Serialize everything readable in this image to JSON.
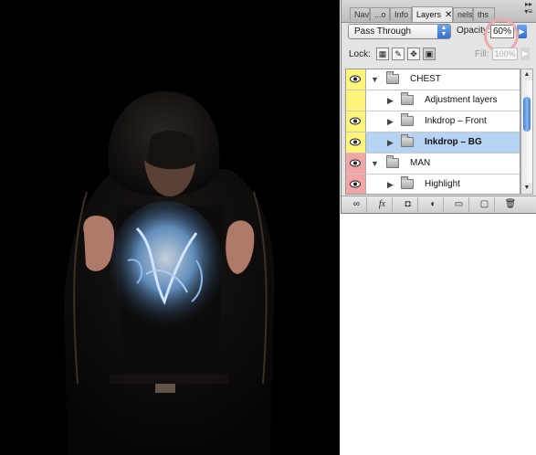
{
  "canvas": {
    "background": "#000000",
    "subject": "hooded-man-with-inkdrop-chest"
  },
  "layers_panel": {
    "tabs": [
      {
        "label": "Nav",
        "active": false
      },
      {
        "label": "...o",
        "active": false
      },
      {
        "label": "Info",
        "active": false
      },
      {
        "label": "Layers",
        "active": true,
        "close": "✕"
      },
      {
        "label": "nels",
        "active": false
      },
      {
        "label": "ths",
        "active": false
      }
    ],
    "panel_menu_icon": "panel-menu-icon",
    "blend_mode": "Pass Through",
    "opacity_label": "Opacity:",
    "opacity_value": "60%",
    "lock_label": "Lock:",
    "fill_label": "Fill:",
    "fill_value": "100%",
    "layers": [
      {
        "name": "CHEST",
        "type": "group",
        "expanded": true,
        "indent": 0,
        "visible": true,
        "color": "#fff57a",
        "selected": false
      },
      {
        "name": "Adjustment layers",
        "type": "group",
        "expanded": false,
        "indent": 1,
        "visible": false,
        "color": "#fff57a",
        "selected": false
      },
      {
        "name": "Inkdrop – Front",
        "type": "group",
        "expanded": false,
        "indent": 1,
        "visible": true,
        "color": "#fff57a",
        "selected": false
      },
      {
        "name": "Inkdrop – BG",
        "type": "group",
        "expanded": false,
        "indent": 1,
        "visible": true,
        "color": "#fff57a",
        "selected": true
      },
      {
        "name": "MAN",
        "type": "group",
        "expanded": true,
        "indent": 0,
        "visible": true,
        "color": "#f3a6a6",
        "selected": false
      },
      {
        "name": "Highlight",
        "type": "group",
        "expanded": false,
        "indent": 1,
        "visible": true,
        "color": "#f3a6a6",
        "selected": false
      }
    ],
    "bottom_tools": [
      "link-icon",
      "fx-icon",
      "mask-icon",
      "adjustment-icon",
      "new-group-icon",
      "new-layer-icon",
      "trash-icon"
    ],
    "bottom_tool_labels": [
      "∞",
      "fx",
      "◘",
      "◐",
      "▭",
      "▢",
      "🗑"
    ],
    "accent": "#3c7bd6",
    "highlight_circle_color": "#f0a7a7"
  }
}
